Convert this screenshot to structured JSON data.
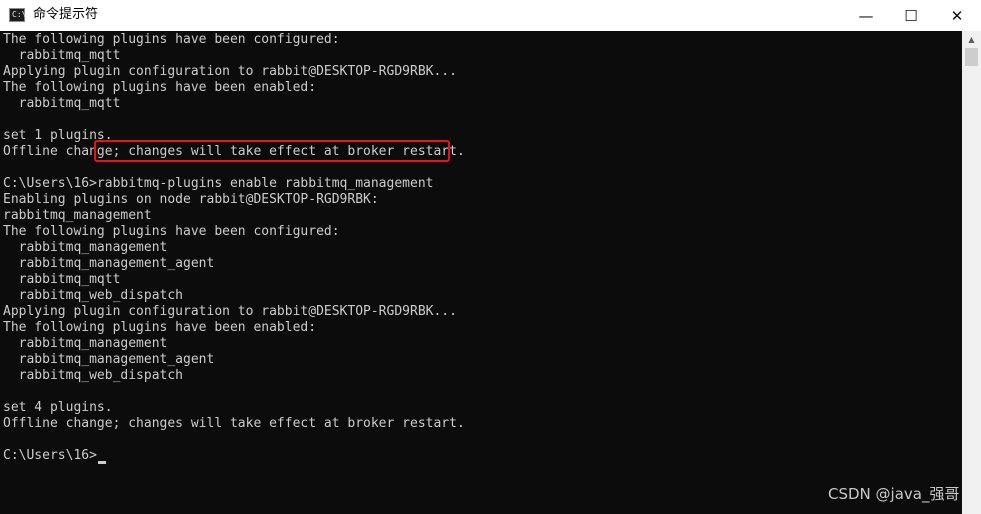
{
  "window": {
    "title": "命令提示符",
    "icon_text": "C:\\",
    "controls": {
      "minimize": "—",
      "maximize": "☐",
      "close": "✕"
    }
  },
  "console": {
    "lines": [
      "The following plugins have been configured:",
      "  rabbitmq_mqtt",
      "Applying plugin configuration to rabbit@DESKTOP-RGD9RBK...",
      "The following plugins have been enabled:",
      "  rabbitmq_mqtt",
      "",
      "set 1 plugins.",
      "Offline change; changes will take effect at broker restart.",
      "",
      "C:\\Users\\16>rabbitmq-plugins enable rabbitmq_management",
      "Enabling plugins on node rabbit@DESKTOP-RGD9RBK:",
      "rabbitmq_management",
      "The following plugins have been configured:",
      "  rabbitmq_management",
      "  rabbitmq_management_agent",
      "  rabbitmq_mqtt",
      "  rabbitmq_web_dispatch",
      "Applying plugin configuration to rabbit@DESKTOP-RGD9RBK...",
      "The following plugins have been enabled:",
      "  rabbitmq_management",
      "  rabbitmq_management_agent",
      "  rabbitmq_web_dispatch",
      "",
      "set 4 plugins.",
      "Offline change; changes will take effect at broker restart.",
      "",
      "C:\\Users\\16>"
    ]
  },
  "scrollbar": {
    "up_arrow": "▲"
  },
  "watermark": "CSDN @java_强哥",
  "colors": {
    "console_bg": "#0c0c0c",
    "console_text": "#cccccc",
    "highlight": "#e81123"
  }
}
